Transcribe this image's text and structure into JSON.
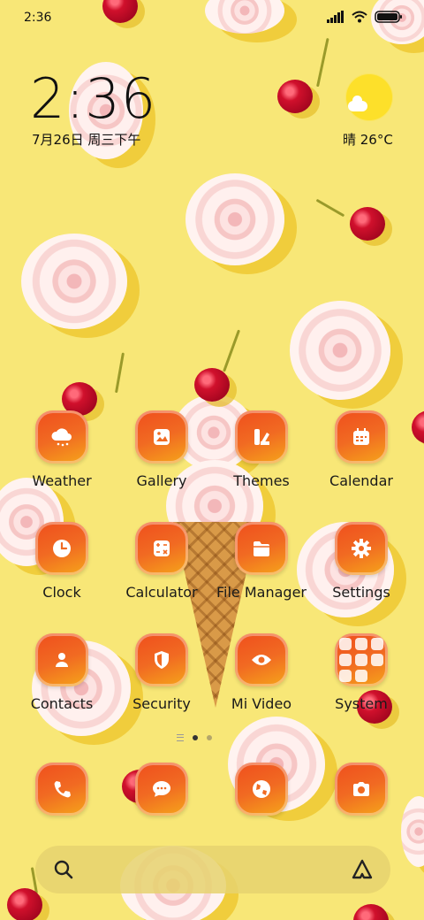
{
  "status_bar": {
    "time": "2:36"
  },
  "clock_widget": {
    "time": "2:36",
    "date": "7月26日 周三下午"
  },
  "weather_widget": {
    "condition_temp": "晴 26°C"
  },
  "apps": [
    {
      "label": "Weather",
      "icon": "weather-icon"
    },
    {
      "label": "Gallery",
      "icon": "gallery-icon"
    },
    {
      "label": "Themes",
      "icon": "themes-icon"
    },
    {
      "label": "Calendar",
      "icon": "calendar-icon"
    },
    {
      "label": "Clock",
      "icon": "clock-icon"
    },
    {
      "label": "Calculator",
      "icon": "calculator-icon"
    },
    {
      "label": "File Manager",
      "icon": "folder-icon"
    },
    {
      "label": "Settings",
      "icon": "gear-icon"
    },
    {
      "label": "Contacts",
      "icon": "contacts-icon"
    },
    {
      "label": "Security",
      "icon": "shield-icon"
    },
    {
      "label": "Mi Video",
      "icon": "eye-icon"
    },
    {
      "label": "System",
      "icon": "folder-grid-icon"
    }
  ],
  "dock": [
    {
      "icon": "phone-icon"
    },
    {
      "icon": "message-icon"
    },
    {
      "icon": "browser-icon"
    },
    {
      "icon": "camera-icon"
    }
  ],
  "colors": {
    "icon_gradient_start": "#ef4e1d",
    "icon_gradient_end": "#f6a61a",
    "background": "#f8e777"
  }
}
